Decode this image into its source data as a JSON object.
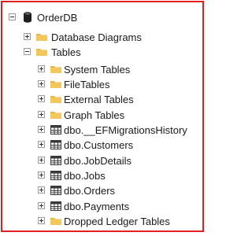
{
  "root": {
    "label": "OrderDB",
    "icon": "database-icon",
    "expanded": true
  },
  "children": [
    {
      "label": "Database Diagrams",
      "icon": "folder-icon",
      "expanded": false
    },
    {
      "label": "Tables",
      "icon": "folder-icon",
      "expanded": true
    }
  ],
  "tables_children": [
    {
      "label": "System Tables",
      "icon": "folder-icon",
      "expanded": false
    },
    {
      "label": "FileTables",
      "icon": "folder-icon",
      "expanded": false
    },
    {
      "label": "External Tables",
      "icon": "folder-icon",
      "expanded": false
    },
    {
      "label": "Graph Tables",
      "icon": "folder-icon",
      "expanded": false
    },
    {
      "label": "dbo.__EFMigrationsHistory",
      "icon": "table-icon",
      "expanded": false
    },
    {
      "label": "dbo.Customers",
      "icon": "table-icon",
      "expanded": false
    },
    {
      "label": "dbo.JobDetails",
      "icon": "table-icon",
      "expanded": false
    },
    {
      "label": "dbo.Jobs",
      "icon": "table-icon",
      "expanded": false
    },
    {
      "label": "dbo.Orders",
      "icon": "table-icon",
      "expanded": false
    },
    {
      "label": "dbo.Payments",
      "icon": "table-icon",
      "expanded": false
    },
    {
      "label": "Dropped Ledger Tables",
      "icon": "folder-icon",
      "expanded": false
    }
  ],
  "colors": {
    "folder": "#e7b94b",
    "border": "#e02020",
    "database": "#1f1f1f",
    "table": "#3a3a3a"
  }
}
